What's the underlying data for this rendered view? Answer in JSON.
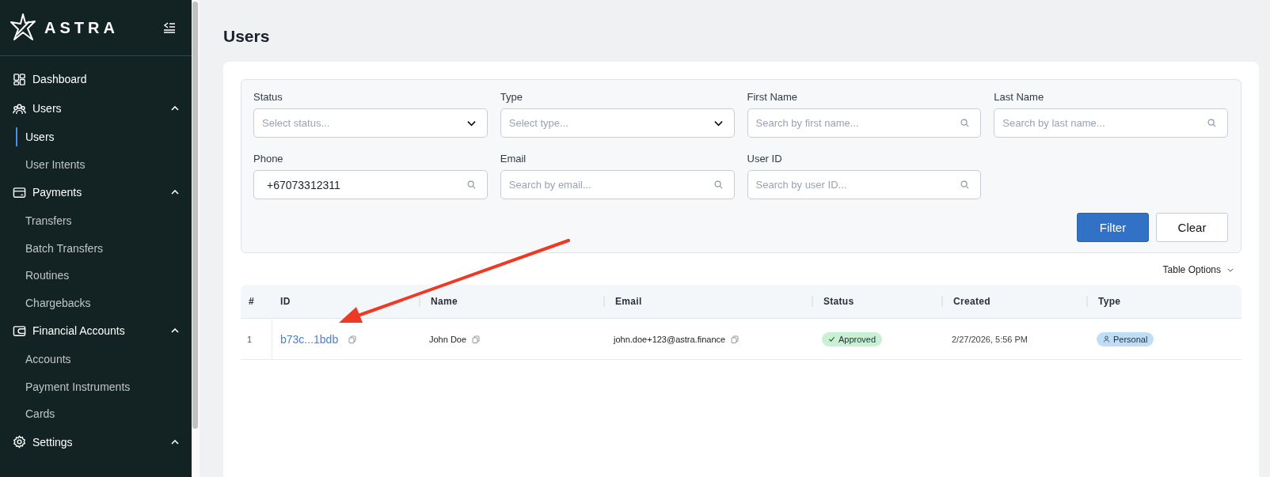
{
  "sidebar": {
    "logo": "ASTRA",
    "items": [
      {
        "label": "Dashboard",
        "kind": "link"
      },
      {
        "label": "Users",
        "kind": "group",
        "expanded": true,
        "children": [
          {
            "label": "Users",
            "selected": true
          },
          {
            "label": "User Intents",
            "selected": false
          }
        ]
      },
      {
        "label": "Payments",
        "kind": "group",
        "expanded": true,
        "children": [
          {
            "label": "Transfers",
            "selected": false
          },
          {
            "label": "Batch Transfers",
            "selected": false
          },
          {
            "label": "Routines",
            "selected": false
          },
          {
            "label": "Chargebacks",
            "selected": false
          }
        ]
      },
      {
        "label": "Financial Accounts",
        "kind": "group",
        "expanded": true,
        "children": [
          {
            "label": "Accounts",
            "selected": false
          },
          {
            "label": "Payment Instruments",
            "selected": false
          },
          {
            "label": "Cards",
            "selected": false
          }
        ]
      },
      {
        "label": "Settings",
        "kind": "group",
        "expanded": true
      }
    ]
  },
  "page_title": "Users",
  "filters": [
    {
      "label": "Status",
      "kind": "select",
      "placeholder": "Select status..."
    },
    {
      "label": "Type",
      "kind": "select",
      "placeholder": "Select type..."
    },
    {
      "label": "First Name",
      "kind": "search",
      "placeholder": "Search by first name..."
    },
    {
      "label": "Last Name",
      "kind": "search",
      "placeholder": "Search by last name..."
    },
    {
      "label": "Phone",
      "kind": "search",
      "value": "+67073312311"
    },
    {
      "label": "Email",
      "kind": "search",
      "placeholder": "Search by email..."
    },
    {
      "label": "User ID",
      "kind": "search",
      "placeholder": "Search by user ID..."
    }
  ],
  "buttons": [
    {
      "label": "Filter",
      "kind": "primary"
    },
    {
      "label": "Clear",
      "kind": "secondary"
    }
  ],
  "table_options": "Table Options",
  "table": {
    "columns": [
      "#",
      "ID",
      "Name",
      "Email",
      "Status",
      "Created",
      "Type"
    ],
    "rows": [
      {
        "number": "1",
        "id": "b73c...1bdb",
        "name": "John Doe",
        "email": "john.doe+123@astra.finance",
        "status": {
          "label": "Approved",
          "color": "#c9f0d3"
        },
        "created": "2/27/2026, 5:56 PM",
        "type": {
          "label": "Personal",
          "color": "#bfdef5"
        }
      }
    ]
  },
  "annotation": {
    "kind": "arrow"
  }
}
